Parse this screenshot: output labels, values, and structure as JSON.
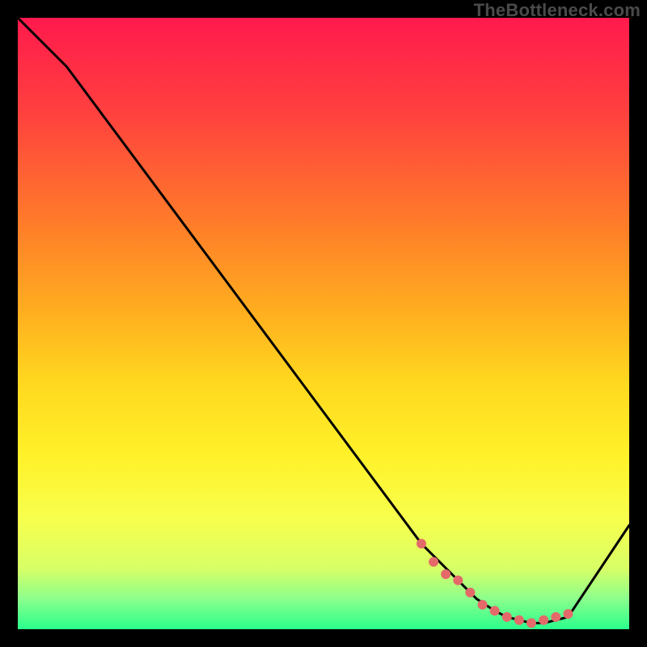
{
  "watermark": "TheBottleneck.com",
  "chart_data": {
    "type": "line",
    "title": "",
    "xlabel": "",
    "ylabel": "",
    "xlim": [
      0,
      100
    ],
    "ylim": [
      0,
      100
    ],
    "grid": false,
    "legend": false,
    "series": [
      {
        "name": "curve",
        "color": "#000000",
        "x": [
          0,
          8,
          66,
          72,
          75,
          78,
          80,
          82,
          84,
          86,
          88,
          90,
          100
        ],
        "y": [
          100,
          92,
          14,
          8,
          5,
          3,
          2,
          1.5,
          1,
          1,
          1.5,
          2,
          17
        ]
      }
    ],
    "markers": {
      "name": "highlight-dots",
      "color": "#e46a6a",
      "radius_px": 6,
      "x": [
        66,
        68,
        70,
        72,
        74,
        76,
        78,
        80,
        82,
        84,
        86,
        88,
        90
      ],
      "y": [
        14,
        11,
        9,
        8,
        6,
        4,
        3,
        2,
        1.5,
        1,
        1.5,
        2,
        2.5
      ]
    }
  }
}
